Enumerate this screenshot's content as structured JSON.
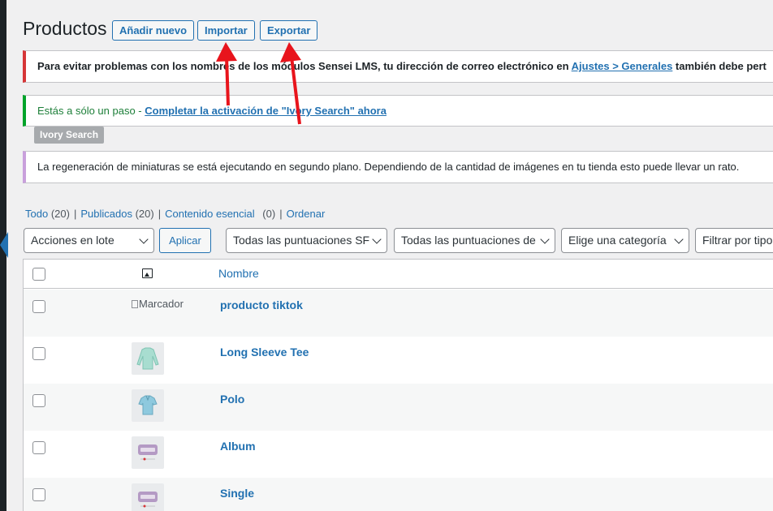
{
  "page": {
    "title": "Productos",
    "buttons": {
      "add_new": "Añadir nuevo",
      "import": "Importar",
      "export": "Exportar"
    }
  },
  "notices": {
    "sensei": {
      "text": "Para evitar problemas con los nombres de los módulos Sensei LMS, tu dirección de correo electrónico en ",
      "link": "Ajustes > Generales",
      "suffix": " también debe pert"
    },
    "ivory": {
      "text": "Estás a sólo un paso - ",
      "link": "Completar la activación de \"Ivory Search\" ahora",
      "badge": "Ivory Search"
    },
    "regen": {
      "text": "La regeneración de miniaturas se está ejecutando en segundo plano. Dependiendo de la cantidad de imágenes en tu tienda esto puede llevar un rato."
    }
  },
  "views": [
    {
      "label": "Todo",
      "count": "(20)"
    },
    {
      "label": "Publicados",
      "count": "(20)"
    },
    {
      "label": "Contenido esencial",
      "count": "(0)"
    },
    {
      "label": "Ordenar",
      "count": ""
    }
  ],
  "filters": {
    "bulk_actions": "Acciones en lote",
    "apply": "Aplicar",
    "sf_ratings": "Todas las puntuaciones SF",
    "ratings": "Todas las puntuaciones de",
    "category": "Elige una categoría",
    "type": "Filtrar por tipo"
  },
  "table": {
    "column_name": "Nombre",
    "rows": [
      {
        "name": "producto tiktok",
        "thumb": "broken",
        "thumb_alt": "Marcador"
      },
      {
        "name": "Long Sleeve Tee",
        "thumb": "longsleeve"
      },
      {
        "name": "Polo",
        "thumb": "polo"
      },
      {
        "name": "Album",
        "thumb": "woo"
      },
      {
        "name": "Single",
        "thumb": "woo"
      }
    ]
  },
  "colors": {
    "accent": "#2271b1",
    "error": "#d63638",
    "success": "#00a32a",
    "annotation_arrow": "#e8141c"
  }
}
